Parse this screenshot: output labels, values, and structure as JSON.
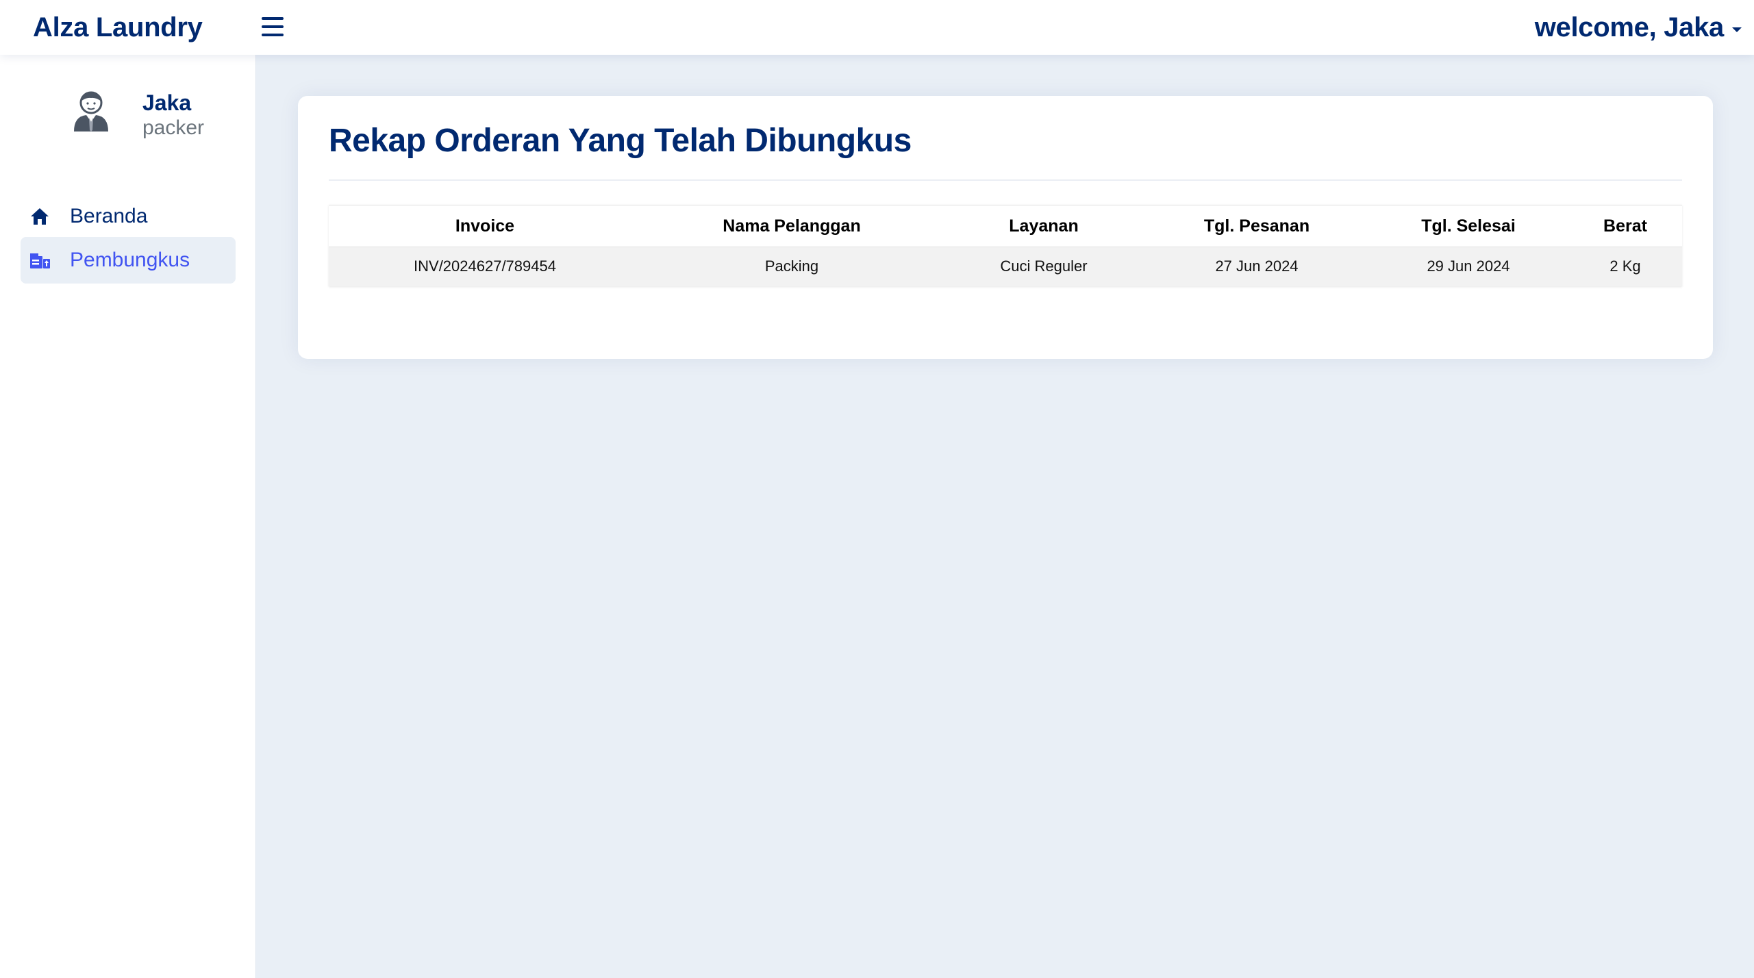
{
  "app": {
    "brand": "Alza Laundry",
    "welcome": "welcome, Jaka"
  },
  "profile": {
    "name": "Jaka",
    "role": "packer"
  },
  "sidebar": {
    "items": [
      {
        "label": "Beranda",
        "icon": "home-icon",
        "active": false
      },
      {
        "label": "Pembungkus",
        "icon": "package-icon",
        "active": true
      }
    ]
  },
  "main": {
    "title": "Rekap Orderan Yang Telah Dibungkus",
    "table": {
      "columns": [
        "Invoice",
        "Nama Pelanggan",
        "Layanan",
        "Tgl. Pesanan",
        "Tgl. Selesai",
        "Berat"
      ],
      "rows": [
        [
          "INV/2024627/789454",
          "Packing",
          "Cuci Reguler",
          "27 Jun 2024",
          "29 Jun 2024",
          "2 Kg"
        ]
      ]
    }
  },
  "colors": {
    "primary": "#012970",
    "accent": "#4154f1",
    "background": "#e9eff6",
    "muted": "#6c757d"
  }
}
